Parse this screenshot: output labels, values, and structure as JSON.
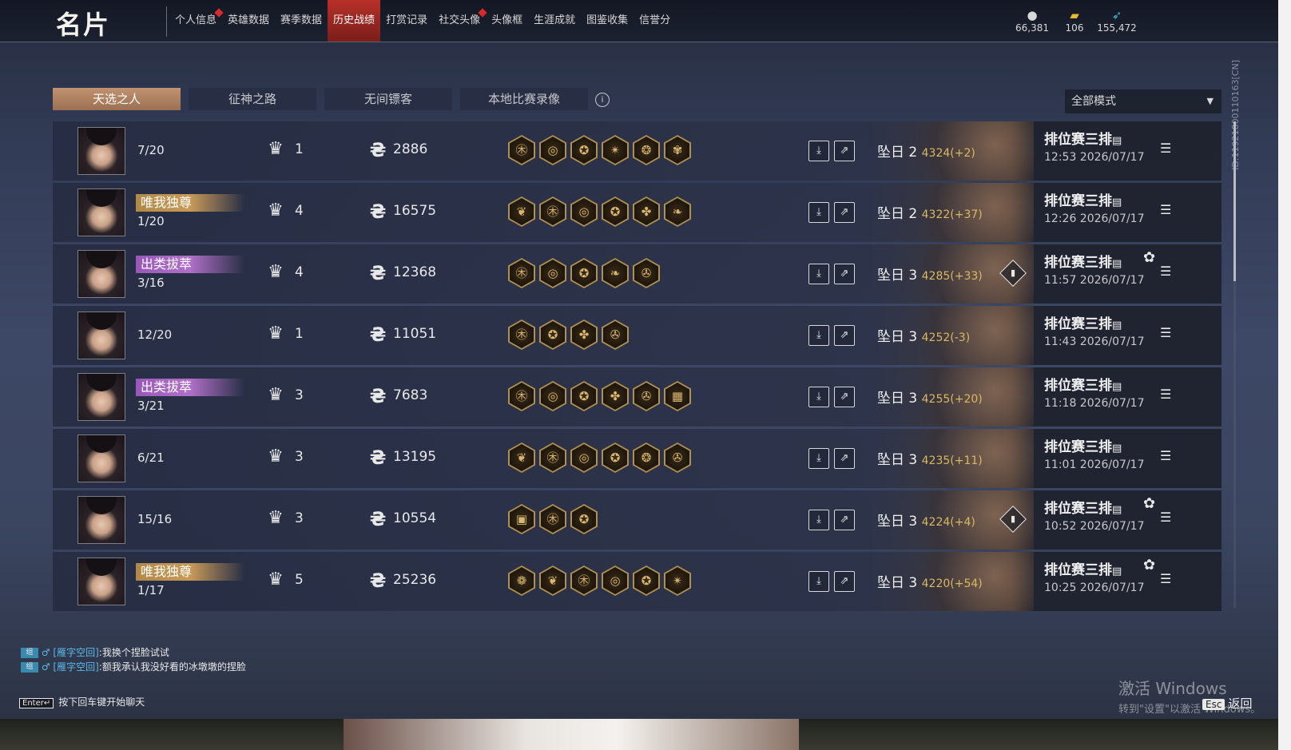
{
  "header": {
    "title": "名片",
    "nav": [
      {
        "label": "个人信息",
        "dot": true
      },
      {
        "label": "英雄数据",
        "dot": false
      },
      {
        "label": "赛季数据",
        "dot": false
      },
      {
        "label": "历史战绩",
        "dot": false,
        "active": true
      },
      {
        "label": "打赏记录",
        "dot": false
      },
      {
        "label": "社交头像",
        "dot": true
      },
      {
        "label": "头像框",
        "dot": false
      },
      {
        "label": "生涯成就",
        "dot": false
      },
      {
        "label": "图鉴收集",
        "dot": false
      },
      {
        "label": "信誉分",
        "dot": false
      }
    ],
    "currencies": [
      {
        "icon": "coin-icon",
        "value": "66,381"
      },
      {
        "icon": "ticket-icon",
        "value": "106"
      },
      {
        "icon": "feather-icon",
        "value": "155,472"
      }
    ],
    "side_id": "ID:1192180011016​3[CN]"
  },
  "tabs": [
    "天选之人",
    "征神之路",
    "无间镖客",
    "本地比赛录像"
  ],
  "mode_select": "全部模式",
  "matches": [
    {
      "title": "",
      "title_style": "",
      "kda": "7/20",
      "rank": "1",
      "score": "2886",
      "items": [
        "㊍",
        "◎",
        "✪",
        "✴",
        "❂",
        "✾"
      ],
      "tier": "坠日 2",
      "points": "4324(+2)",
      "mvp": false,
      "mode": "排位赛三排",
      "time": "12:53  2026/07/17",
      "gear": false
    },
    {
      "title": "唯我独尊",
      "title_style": "gold",
      "kda": "1/20",
      "rank": "4",
      "score": "16575",
      "items": [
        "❦",
        "㊍",
        "◎",
        "✪",
        "✤",
        "❧"
      ],
      "tier": "坠日 2",
      "points": "4322(+37)",
      "mvp": false,
      "mode": "排位赛三排",
      "time": "12:26  2026/07/17",
      "gear": false
    },
    {
      "title": "出类拔萃",
      "title_style": "purple",
      "kda": "3/16",
      "rank": "4",
      "score": "12368",
      "items": [
        "㊍",
        "◎",
        "✪",
        "❧",
        "✇"
      ],
      "tier": "坠日 3",
      "points": "4285(+33)",
      "mvp": true,
      "mode": "排位赛三排",
      "time": "11:57  2026/07/17",
      "gear": true
    },
    {
      "title": "",
      "title_style": "",
      "kda": "12/20",
      "rank": "1",
      "score": "11051",
      "items": [
        "㊍",
        "✪",
        "✤",
        "✇"
      ],
      "tier": "坠日 3",
      "points": "4252(-3)",
      "mvp": false,
      "mode": "排位赛三排",
      "time": "11:43  2026/07/17",
      "gear": false
    },
    {
      "title": "出类拔萃",
      "title_style": "purple",
      "kda": "3/21",
      "rank": "3",
      "score": "7683",
      "items": [
        "㊍",
        "◎",
        "✪",
        "✤",
        "✇",
        "▦"
      ],
      "tier": "坠日 3",
      "points": "4255(+20)",
      "mvp": false,
      "mode": "排位赛三排",
      "time": "11:18  2026/07/17",
      "gear": false
    },
    {
      "title": "",
      "title_style": "",
      "kda": "6/21",
      "rank": "3",
      "score": "13195",
      "items": [
        "❦",
        "㊍",
        "◎",
        "✪",
        "❂",
        "✇"
      ],
      "tier": "坠日 3",
      "points": "4235(+11)",
      "mvp": false,
      "mode": "排位赛三排",
      "time": "11:01  2026/07/17",
      "gear": false
    },
    {
      "title": "",
      "title_style": "",
      "kda": "15/16",
      "rank": "3",
      "score": "10554",
      "items": [
        "▣",
        "㊍",
        "✪"
      ],
      "tier": "坠日 3",
      "points": "4224(+4)",
      "mvp": true,
      "mode": "排位赛三排",
      "time": "10:52  2026/07/17",
      "gear": true
    },
    {
      "title": "唯我独尊",
      "title_style": "gold",
      "kda": "1/17",
      "rank": "5",
      "score": "25236",
      "items": [
        "❁",
        "❦",
        "㊍",
        "◎",
        "✪",
        "✴"
      ],
      "tier": "坠日 3",
      "points": "4220(+54)",
      "mvp": false,
      "mode": "排位赛三排",
      "time": "10:25  2026/07/17",
      "gear": true
    }
  ],
  "chat": [
    {
      "name": "[雁字空回]",
      "text": ":我换个捏脸试试"
    },
    {
      "name": "[雁字空回]",
      "text": ":额我承认我没好看的冰墩墩的捏脸"
    }
  ],
  "chat_channel": "组",
  "chat_hint_key": "Enter↵",
  "chat_hint": "按下回车键开始聊天",
  "watermark_line1": "激活 Windows",
  "watermark_line2": "转到\"设置\"以激活 Windows。",
  "esc_key": "Esc",
  "esc_label": "返回"
}
